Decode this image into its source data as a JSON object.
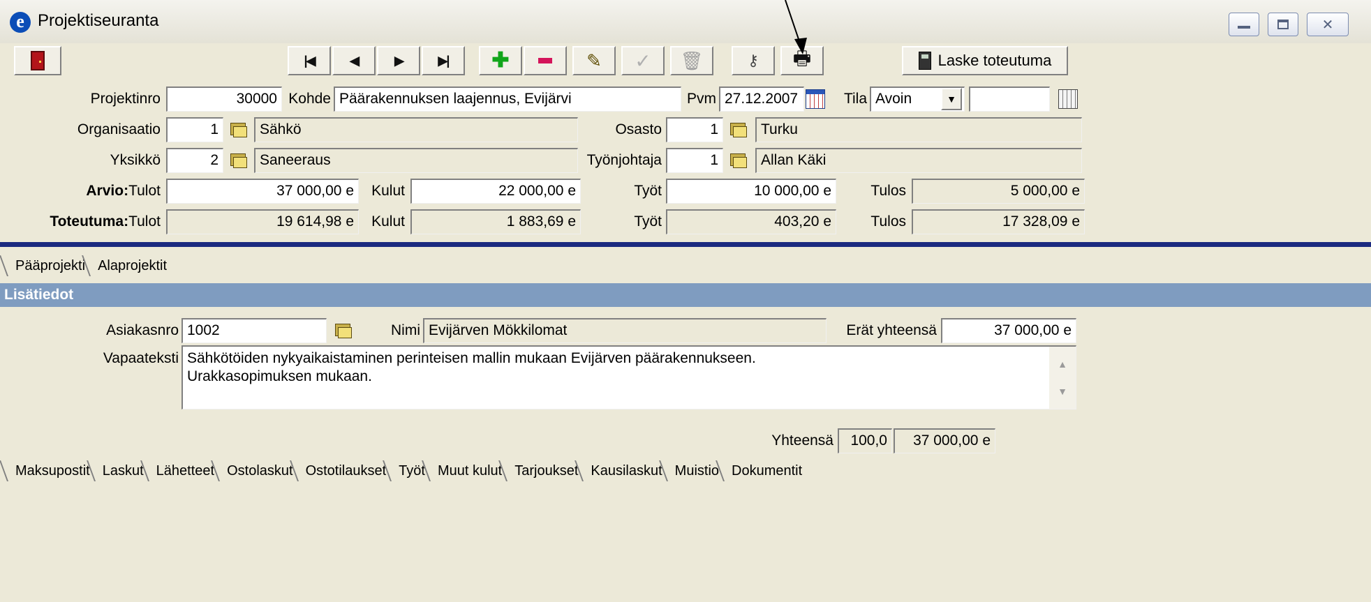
{
  "window": {
    "title": "Projektiseuranta",
    "controls": [
      "minimize",
      "maximize",
      "close"
    ]
  },
  "toolbar": {
    "buttons": [
      {
        "name": "exit",
        "icon": "door-icon"
      },
      {
        "name": "first",
        "glyph": "|◀"
      },
      {
        "name": "previous",
        "glyph": "◀"
      },
      {
        "name": "next",
        "glyph": "▶"
      },
      {
        "name": "last",
        "glyph": "▶|"
      },
      {
        "name": "add",
        "icon": "plus-icon"
      },
      {
        "name": "remove",
        "icon": "minus-icon"
      },
      {
        "name": "edit",
        "icon": "pencil-icon"
      },
      {
        "name": "accept",
        "icon": "check-icon",
        "enabled": false
      },
      {
        "name": "delete",
        "icon": "trash-icon",
        "enabled": false
      },
      {
        "name": "search",
        "icon": "key-icon"
      },
      {
        "name": "print",
        "icon": "printer-icon"
      }
    ],
    "calculate_label": "Laske toteutuma"
  },
  "header": {
    "projektinro_label": "Projektinro",
    "projektinro": "30000",
    "kohde_label": "Kohde",
    "kohde": "Päärakennuksen laajennus, Evijärvi",
    "pvm_label": "Pvm",
    "pvm": "27.12.2007",
    "tila_label": "Tila",
    "tila": "Avoin",
    "tila_extra": "",
    "organisaatio_label": "Organisaatio",
    "organisaatio_id": "1",
    "organisaatio_name": "Sähkö",
    "osasto_label": "Osasto",
    "osasto_id": "1",
    "osasto_name": "Turku",
    "yksikko_label": "Yksikkö",
    "yksikko_id": "2",
    "yksikko_name": "Saneeraus",
    "tyonjohtaja_label": "Työnjohtaja",
    "tyonjohtaja_id": "1",
    "tyonjohtaja_name": "Allan Käki"
  },
  "totals": {
    "arvio_label": "Arvio:",
    "toteutuma_label": "Toteutuma:",
    "tulot_label": "Tulot",
    "kulut_label": "Kulut",
    "tyot_label": "Työt",
    "tulos_label": "Tulos",
    "arvio": {
      "tulot": "37 000,00 e",
      "kulut": "22 000,00 e",
      "tyot": "10 000,00 e",
      "tulos": "5 000,00 e"
    },
    "toteutuma": {
      "tulot": "19 614,98 e",
      "kulut": "1 883,69 e",
      "tyot": "403,20 e",
      "tulos": "17 328,09 e"
    }
  },
  "project_tabs": [
    "Pääprojekti",
    "Alaprojektit"
  ],
  "details": {
    "section_title": "Lisätiedot",
    "asiakasnro_label": "Asiakasnro",
    "asiakasnro": "1002",
    "nimi_label": "Nimi",
    "nimi": "Evijärven Mökkilomat",
    "erat_label": "Erät yhteensä",
    "erat": "37 000,00 e",
    "vapaateksti_label": "Vapaateksti",
    "vapaateksti_line1": "Sähkötöiden nykyaikaistaminen perinteisen mallin mukaan Evijärven päärakennukseen.",
    "vapaateksti_line2": "Urakkasopimuksen mukaan.",
    "yhteensa_label": "Yhteensä",
    "yhteensa_percent": "100,0",
    "yhteensa_amount": "37 000,00 e"
  },
  "bottom_tabs": [
    "Maksupostit",
    "Laskut",
    "Lähetteet",
    "Ostolaskut",
    "Ostotilaukset",
    "Työt",
    "Muut kulut",
    "Tarjoukset",
    "Kausilaskut",
    "Muistio",
    "Dokumentit"
  ]
}
